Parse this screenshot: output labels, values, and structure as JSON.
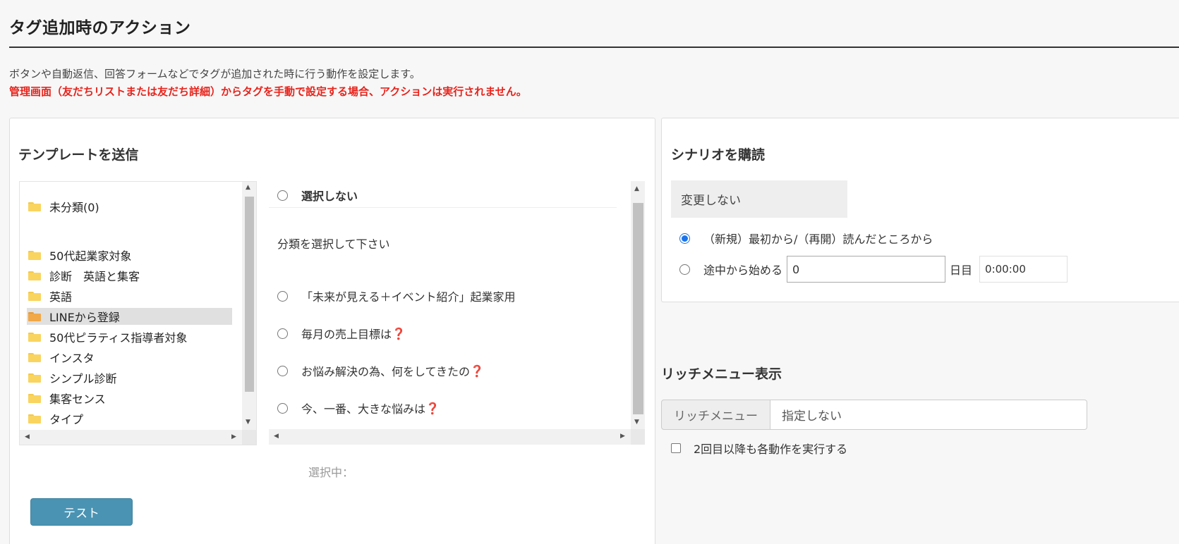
{
  "page": {
    "title": "タグ追加時のアクション",
    "description": "ボタンや自動返信、回答フォームなどでタグが追加された時に行う動作を設定します。",
    "warning": "管理画面（友だちリストまたは友だち詳細）からタグを手動で設定する場合、アクションは実行されません。"
  },
  "template_section": {
    "title": "テンプレートを送信",
    "folders": [
      {
        "label": "未分類(0)",
        "selected": false
      },
      {
        "label": "50代起業家対象",
        "selected": false
      },
      {
        "label": "診断　英語と集客",
        "selected": false
      },
      {
        "label": "英語",
        "selected": false
      },
      {
        "label": "LINEから登録",
        "selected": true
      },
      {
        "label": "50代ピラティス指導者対象",
        "selected": false
      },
      {
        "label": "インスタ",
        "selected": false
      },
      {
        "label": "シンプル診断",
        "selected": false
      },
      {
        "label": "集客センス",
        "selected": false
      },
      {
        "label": "タイプ",
        "selected": false
      }
    ],
    "no_select_label": "選択しない",
    "category_hint": "分類を選択して下さい",
    "templates": [
      {
        "label": "「未来が見える＋イベント紹介」起業家用",
        "mark": ""
      },
      {
        "label": "毎月の売上目標は",
        "mark": "❓"
      },
      {
        "label": "お悩み解決の為、何をしてきたの",
        "mark": "❓"
      },
      {
        "label": "今、一番、大きな悩みは",
        "mark": "❓"
      }
    ],
    "selected_label": "選択中：",
    "test_button": "テスト"
  },
  "scenario_section": {
    "title": "シナリオを購読",
    "no_change": "変更しない",
    "option_from_start": "（新規）最初から/（再開）読んだところから",
    "option_from_middle": "途中から始める",
    "day_value": "0",
    "day_unit": "日目",
    "time_value": "0:00:00"
  },
  "rich_menu_section": {
    "title": "リッチメニュー表示",
    "addon_label": "リッチメニュー",
    "value": "指定しない"
  },
  "repeat_checkbox_label": "2回目以降も各動作を実行する"
}
